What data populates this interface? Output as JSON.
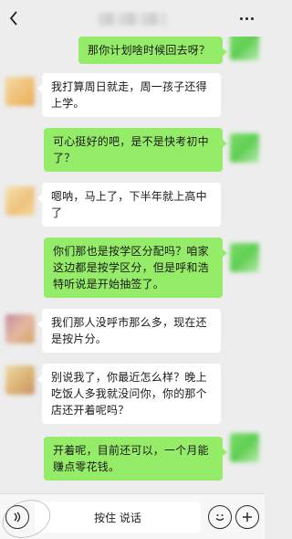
{
  "input_bar": {
    "hold_to_talk_label": "按住 说话",
    "voice_icon": "voice-icon",
    "emoji_icon": "emoji-icon",
    "plus_icon": "plus-icon"
  },
  "messages": [
    {
      "sender": "me",
      "text": "那你计划啥时候回去呀？"
    },
    {
      "sender": "other",
      "text": "我打算周日就走，周一孩子还得上学。"
    },
    {
      "sender": "me",
      "text": "可心挺好的吧，是不是快考初中了？"
    },
    {
      "sender": "other",
      "text": "嗯呐，马上了，下半年就上高中了"
    },
    {
      "sender": "me",
      "text": "你们那也是按学区分配吗？咱家这边都是按学区分，但是呼和浩特听说是开始抽签了。"
    },
    {
      "sender": "other",
      "text": "我们那人没呼市那么多，现在还是按片分。"
    },
    {
      "sender": "other",
      "text": "别说我了，你最近怎么样？晚上吃饭人多我就没问你，你的那个店还开着呢吗？"
    },
    {
      "sender": "me",
      "text": "开着呢，目前还可以，一个月能赚点零花钱。"
    }
  ],
  "colors": {
    "background": "#ededed",
    "my_bubble": "#95ec69",
    "other_bubble": "#ffffff"
  },
  "titlebar": {
    "back_icon": "back-arrow-icon",
    "more_icon": "more-dots-icon"
  }
}
